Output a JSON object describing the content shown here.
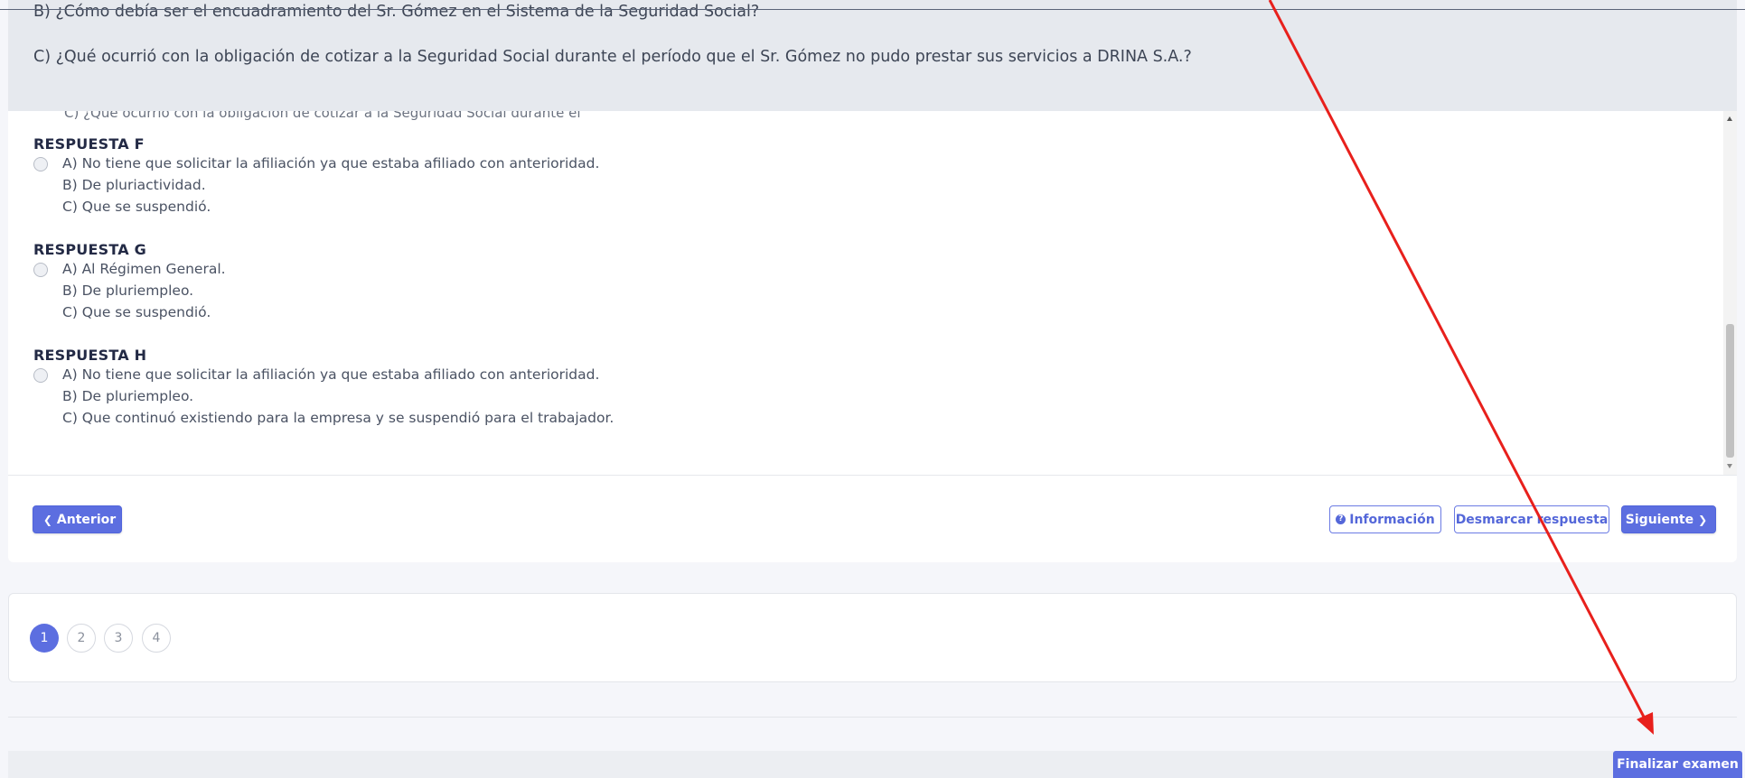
{
  "question": {
    "line_b": "B) ¿Cómo debía ser el encuadramiento del Sr. Gómez en el Sistema de la Seguridad Social?",
    "line_c": "C) ¿Qué ocurrió con la obligación de cotizar a la Seguridad Social durante el período que el Sr. Gómez no pudo prestar sus servicios a DRINA S.A.?"
  },
  "cut_off_text": "C) ¿Qué ocurrió con la obligación de cotizar a la Seguridad Social durante el",
  "answers": [
    {
      "title": "RESPUESTA F",
      "options": [
        "A) No tiene que solicitar la afiliación ya que estaba afiliado con anterioridad.",
        "B) De pluriactividad.",
        "C) Que se suspendió."
      ]
    },
    {
      "title": "RESPUESTA G",
      "options": [
        "A) Al Régimen General.",
        "B) De pluriempleo.",
        "C) Que se suspendió."
      ]
    },
    {
      "title": "RESPUESTA H",
      "options": [
        "A) No tiene que solicitar la afiliación ya que estaba afiliado con anterioridad.",
        "B) De pluriempleo.",
        "C) Que continuó existiendo para la empresa y se suspendió para el trabajador."
      ]
    }
  ],
  "nav": {
    "prev_label": "Anterior",
    "info_label": "Información",
    "unmark_label": "Desmarcar respuesta",
    "next_label": "Siguiente"
  },
  "pagination": {
    "pages": [
      "1",
      "2",
      "3",
      "4"
    ],
    "current": "1"
  },
  "footer": {
    "finalize_label": "Finalizar examen"
  },
  "icons": {
    "prev": "chevron-left-icon",
    "next": "chevron-right-icon",
    "info": "question-circle-icon"
  },
  "colors": {
    "accent": "#5c6ee0",
    "annotation_arrow": "#e8201c"
  }
}
